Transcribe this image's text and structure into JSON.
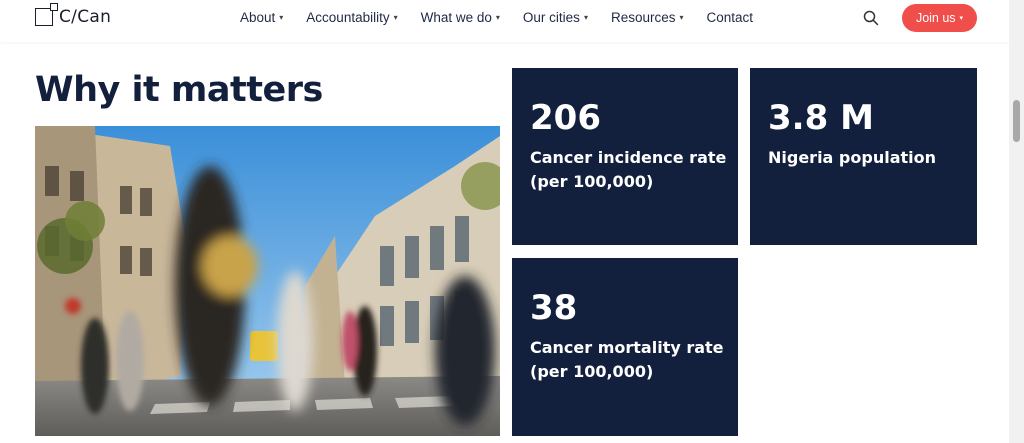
{
  "brand": {
    "logo_text": "C/Can"
  },
  "nav": {
    "items": [
      {
        "label": "About",
        "has_menu": true
      },
      {
        "label": "Accountability",
        "has_menu": true
      },
      {
        "label": "What we do",
        "has_menu": true
      },
      {
        "label": "Our cities",
        "has_menu": true
      },
      {
        "label": "Resources",
        "has_menu": true
      },
      {
        "label": "Contact",
        "has_menu": false
      }
    ],
    "join_label": "Join us"
  },
  "section": {
    "heading": "Why it matters",
    "stats": [
      {
        "value": "206",
        "label": "Cancer incidence rate (per 100,000)"
      },
      {
        "value": "3.8 M",
        "label": "Nigeria population"
      },
      {
        "value": "38",
        "label": "Cancer mortality rate (per 100,000)"
      }
    ]
  },
  "colors": {
    "navy": "#13203d",
    "accent": "#ef4e4b",
    "white": "#ffffff"
  }
}
